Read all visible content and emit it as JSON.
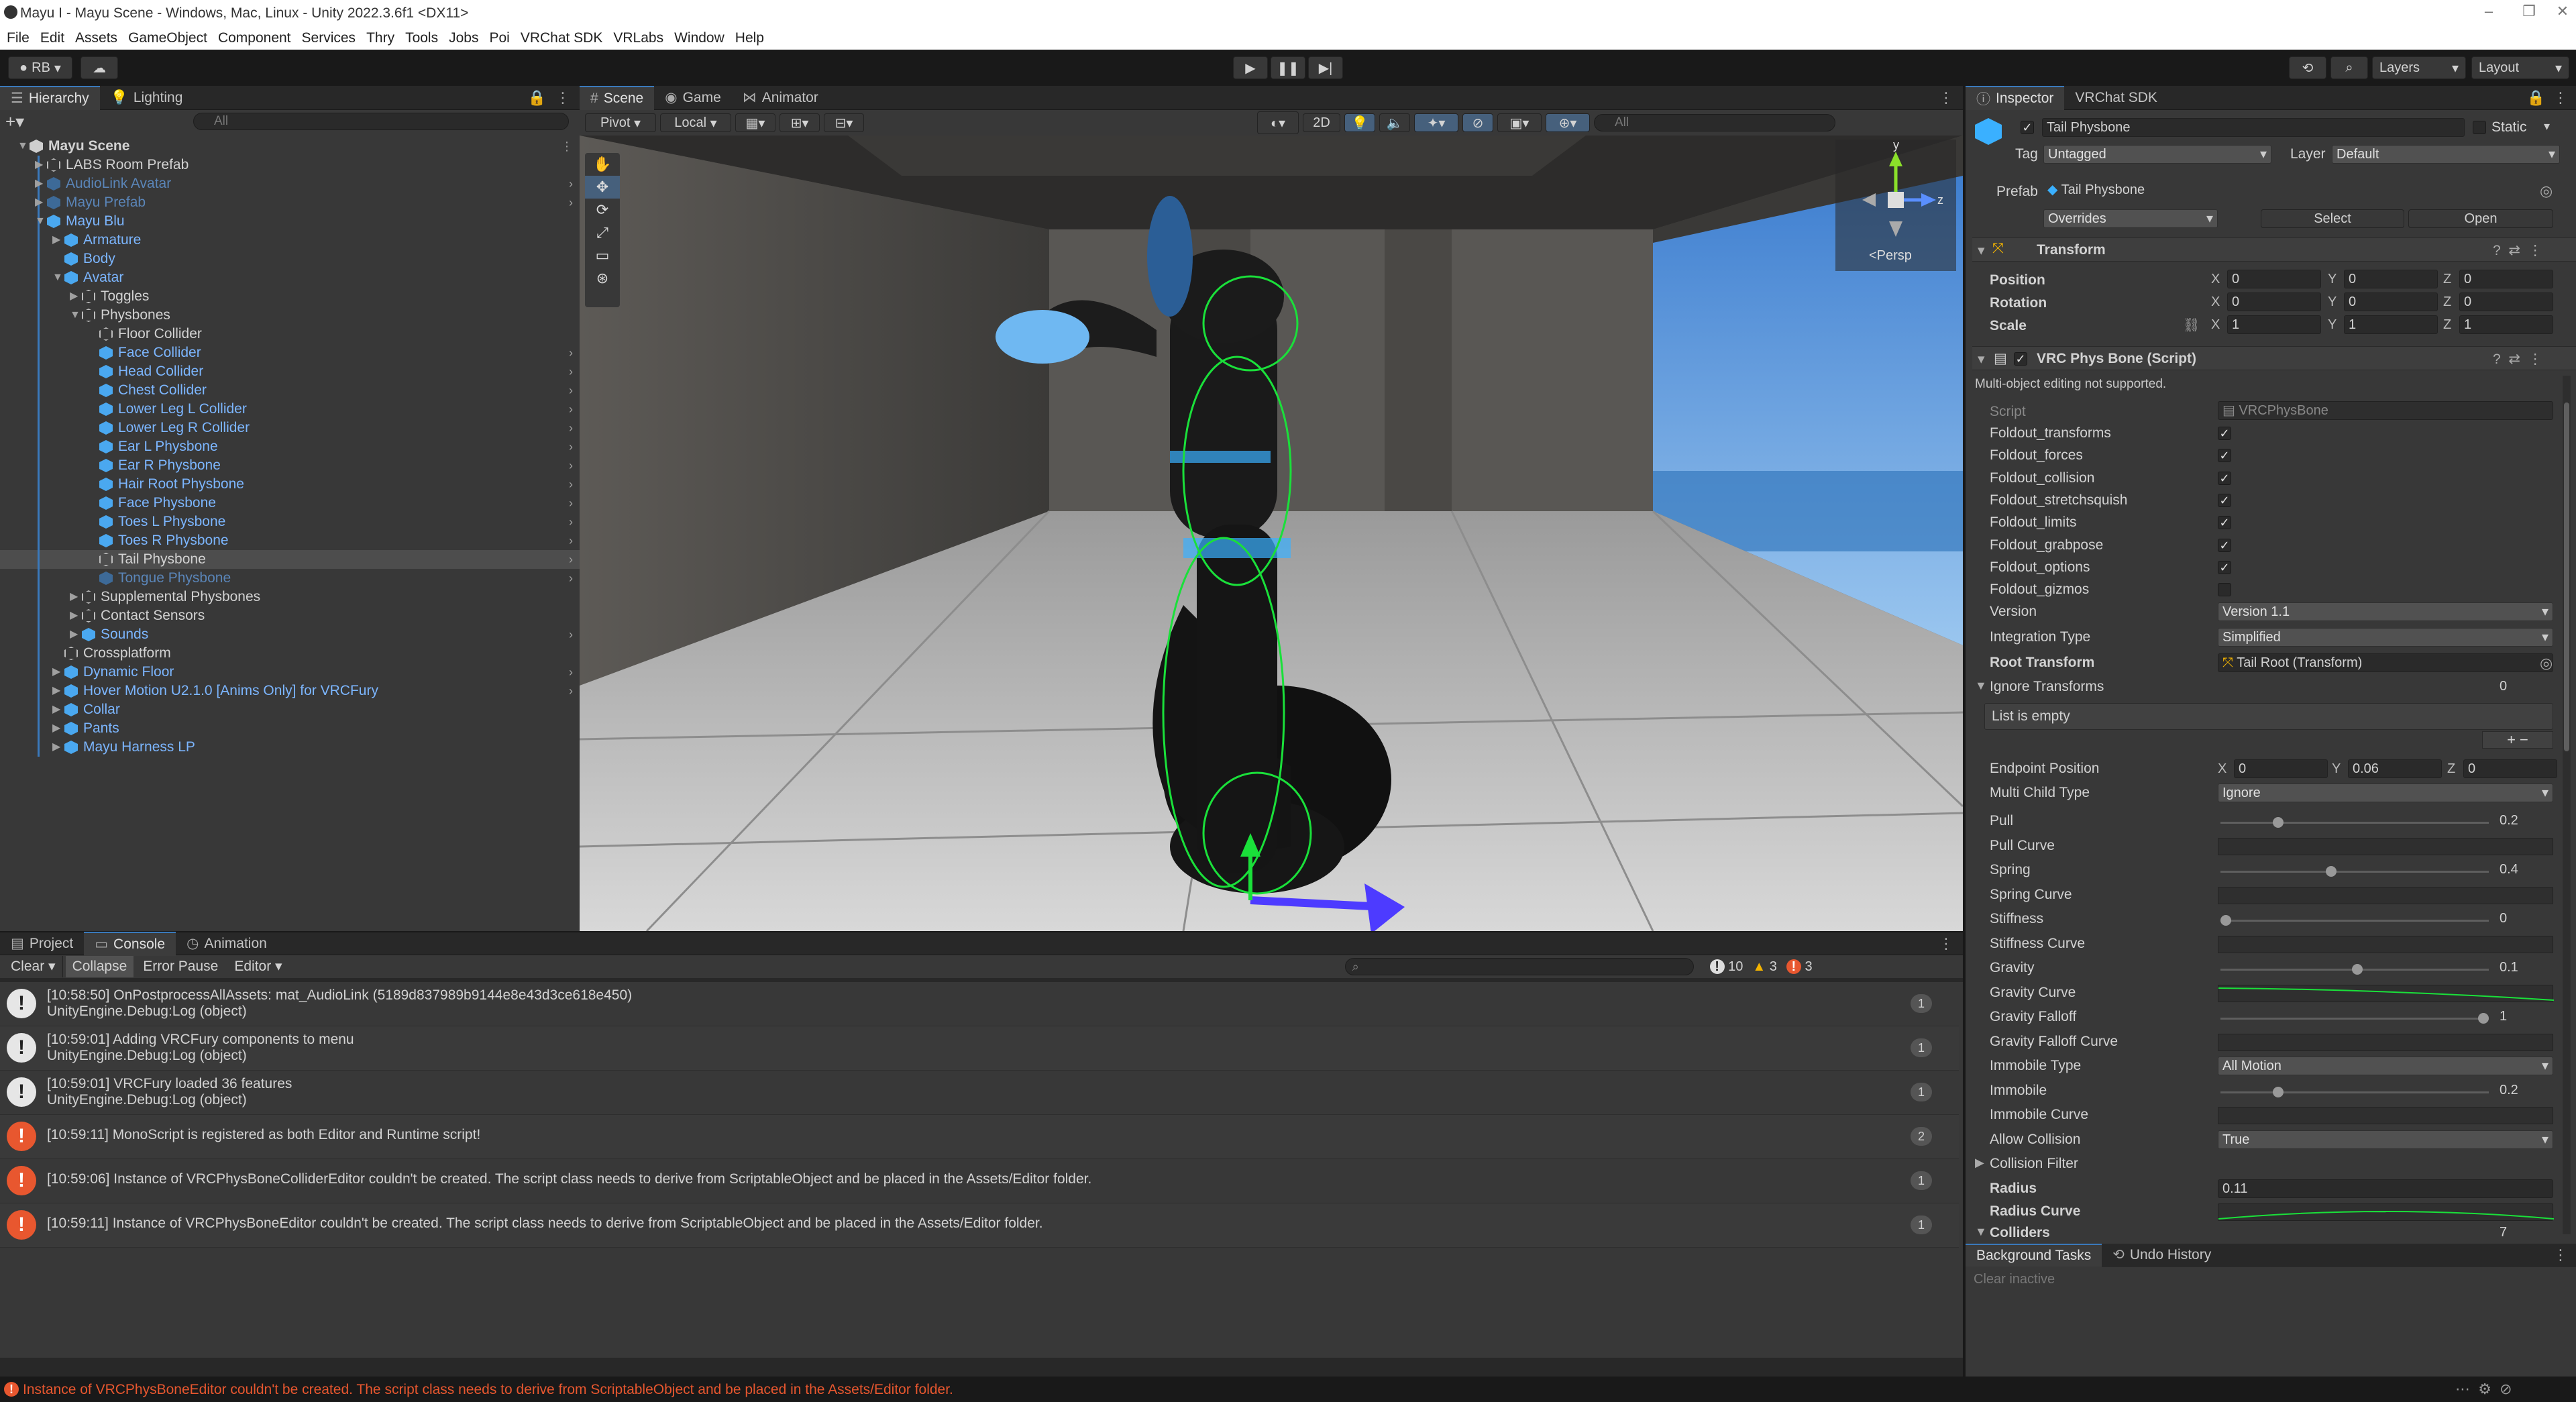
{
  "window": {
    "title": "Mayu I - Mayu Scene - Windows, Mac, Linux - Unity 2022.3.6f1 <DX11>"
  },
  "menu": [
    "File",
    "Edit",
    "Assets",
    "GameObject",
    "Component",
    "Services",
    "Thry",
    "Tools",
    "Jobs",
    "Poi",
    "VRChat SDK",
    "VRLabs",
    "Window",
    "Help"
  ],
  "toolbar": {
    "account": "RB",
    "layers": "Layers",
    "layout": "Layout"
  },
  "hierarchy": {
    "tabs": [
      "Hierarchy",
      "Lighting"
    ],
    "search_placeholder": "All",
    "rows": [
      {
        "label": "Mayu Scene",
        "depth": 0,
        "kind": "scene",
        "arrow": "down"
      },
      {
        "label": "LABS Room Prefab",
        "depth": 1,
        "kind": "obj",
        "arrow": "right"
      },
      {
        "label": "AudioLink Avatar",
        "depth": 1,
        "kind": "prefabdim",
        "arrow": "right",
        "chev": true
      },
      {
        "label": "Mayu Prefab",
        "depth": 1,
        "kind": "prefabdim",
        "arrow": "right",
        "chev": true
      },
      {
        "label": "Mayu Blu",
        "depth": 1,
        "kind": "prefab",
        "arrow": "down"
      },
      {
        "label": "Armature",
        "depth": 2,
        "kind": "prefab",
        "arrow": "right"
      },
      {
        "label": "Body",
        "depth": 2,
        "kind": "prefab",
        "arrow": ""
      },
      {
        "label": "Avatar",
        "depth": 2,
        "kind": "prefab",
        "arrow": "down"
      },
      {
        "label": "Toggles",
        "depth": 3,
        "kind": "obj",
        "arrow": "right"
      },
      {
        "label": "Physbones",
        "depth": 3,
        "kind": "obj",
        "arrow": "down"
      },
      {
        "label": "Floor Collider",
        "depth": 4,
        "kind": "obj",
        "arrow": ""
      },
      {
        "label": "Face Collider",
        "depth": 4,
        "kind": "prefab",
        "arrow": "",
        "chev": true
      },
      {
        "label": "Head Collider",
        "depth": 4,
        "kind": "prefab",
        "arrow": "",
        "chev": true
      },
      {
        "label": "Chest Collider",
        "depth": 4,
        "kind": "prefab",
        "arrow": "",
        "chev": true
      },
      {
        "label": "Lower Leg L Collider",
        "depth": 4,
        "kind": "prefab",
        "arrow": "",
        "chev": true
      },
      {
        "label": "Lower Leg R Collider",
        "depth": 4,
        "kind": "prefab",
        "arrow": "",
        "chev": true
      },
      {
        "label": "Ear L Physbone",
        "depth": 4,
        "kind": "prefab",
        "arrow": "",
        "chev": true
      },
      {
        "label": "Ear R Physbone",
        "depth": 4,
        "kind": "prefab",
        "arrow": "",
        "chev": true
      },
      {
        "label": "Hair Root Physbone",
        "depth": 4,
        "kind": "prefab",
        "arrow": "",
        "chev": true
      },
      {
        "label": "Face Physbone",
        "depth": 4,
        "kind": "prefab",
        "arrow": "",
        "chev": true
      },
      {
        "label": "Toes L Physbone",
        "depth": 4,
        "kind": "prefab",
        "arrow": "",
        "chev": true
      },
      {
        "label": "Toes R Physbone",
        "depth": 4,
        "kind": "prefab",
        "arrow": "",
        "chev": true
      },
      {
        "label": "Tail Physbone",
        "depth": 4,
        "kind": "obj",
        "arrow": "",
        "chev": true,
        "selected": true
      },
      {
        "label": "Tongue Physbone",
        "depth": 4,
        "kind": "prefabdim",
        "arrow": "",
        "chev": true
      },
      {
        "label": "Supplemental Physbones",
        "depth": 3,
        "kind": "obj",
        "arrow": "right"
      },
      {
        "label": "Contact Sensors",
        "depth": 3,
        "kind": "obj",
        "arrow": "right"
      },
      {
        "label": "Sounds",
        "depth": 3,
        "kind": "prefab",
        "arrow": "right",
        "chev": true
      },
      {
        "label": "Crossplatform",
        "depth": 2,
        "kind": "obj",
        "arrow": ""
      },
      {
        "label": "Dynamic Floor",
        "depth": 2,
        "kind": "prefab",
        "arrow": "right",
        "chev": true
      },
      {
        "label": "Hover Motion U2.1.0 [Anims Only] for VRCFury",
        "depth": 2,
        "kind": "prefab",
        "arrow": "right",
        "chev": true
      },
      {
        "label": "Collar",
        "depth": 2,
        "kind": "prefab",
        "arrow": "right"
      },
      {
        "label": "Pants",
        "depth": 2,
        "kind": "prefab",
        "arrow": "right"
      },
      {
        "label": "Mayu Harness LP",
        "depth": 2,
        "kind": "prefab",
        "arrow": "right"
      }
    ]
  },
  "scene": {
    "tabs": [
      "Scene",
      "Game",
      "Animator"
    ],
    "pivot": "Pivot",
    "local": "Local",
    "mode2d": "2D",
    "search_placeholder": "All",
    "gizmo": {
      "y": "y",
      "z": "z",
      "persp": "<Persp"
    }
  },
  "console": {
    "tabs": [
      "Project",
      "Console",
      "Animation"
    ],
    "buttons": [
      "Clear",
      "Collapse",
      "Error Pause",
      "Editor"
    ],
    "counts": {
      "info": "10",
      "warn": "3",
      "error": "3"
    },
    "entries": [
      {
        "type": "info",
        "line1": "[10:58:50] OnPostprocessAllAssets: mat_AudioLink (5189d837989b9144e8e43d3ce618e450)",
        "line2": "UnityEngine.Debug:Log (object)",
        "count": "1"
      },
      {
        "type": "info",
        "line1": "[10:59:01] Adding VRCFury components to menu",
        "line2": "UnityEngine.Debug:Log (object)",
        "count": "1"
      },
      {
        "type": "info",
        "line1": "[10:59:01] VRCFury loaded 36 features",
        "line2": "UnityEngine.Debug:Log (object)",
        "count": "1"
      },
      {
        "type": "error",
        "line1": "[10:59:11] MonoScript is registered as both Editor and Runtime script!",
        "line2": "",
        "count": "2"
      },
      {
        "type": "error",
        "line1": "[10:59:06] Instance of VRCPhysBoneColliderEditor couldn't be created. The script class needs to derive from ScriptableObject and be placed in the Assets/Editor folder.",
        "line2": "",
        "count": "1"
      },
      {
        "type": "error",
        "line1": "[10:59:11] Instance of VRCPhysBoneEditor couldn't be created. The script class needs to derive from ScriptableObject and be placed in the Assets/Editor folder.",
        "line2": "",
        "count": "1"
      }
    ]
  },
  "statusbar": {
    "message": "Instance of VRCPhysBoneEditor couldn't be created. The script class needs to derive from ScriptableObject and be placed in the Assets/Editor folder."
  },
  "inspector": {
    "tabs": [
      "Inspector",
      "VRChat SDK"
    ],
    "name": "Tail Physbone",
    "static": "Static",
    "tag_label": "Tag",
    "tag": "Untagged",
    "layer_label": "Layer",
    "layer": "Default",
    "prefab_label": "Prefab",
    "prefab": "Tail Physbone",
    "overrides": "Overrides",
    "select": "Select",
    "open": "Open",
    "transform": {
      "title": "Transform",
      "position": {
        "label": "Position",
        "x": "0",
        "y": "0",
        "z": "0"
      },
      "rotation": {
        "label": "Rotation",
        "x": "0",
        "y": "0",
        "z": "0"
      },
      "scale": {
        "label": "Scale",
        "x": "1",
        "y": "1",
        "z": "1"
      }
    },
    "physbone": {
      "title": "VRC Phys Bone (Script)",
      "warning": "Multi-object editing not supported.",
      "script_label": "Script",
      "script": "VRCPhysBone",
      "foldouts": [
        {
          "label": "Foldout_transforms",
          "checked": true
        },
        {
          "label": "Foldout_forces",
          "checked": true
        },
        {
          "label": "Foldout_collision",
          "checked": true
        },
        {
          "label": "Foldout_stretchsquish",
          "checked": true
        },
        {
          "label": "Foldout_limits",
          "checked": true
        },
        {
          "label": "Foldout_grabpose",
          "checked": true
        },
        {
          "label": "Foldout_options",
          "checked": true
        },
        {
          "label": "Foldout_gizmos",
          "checked": false
        }
      ],
      "version_label": "Version",
      "version": "Version 1.1",
      "integration_label": "Integration Type",
      "integration": "Simplified",
      "root_label": "Root Transform",
      "root": "Tail Root (Transform)",
      "ignore_label": "Ignore Transforms",
      "ignore_count": "0",
      "list_empty": "List is empty",
      "endpoint": {
        "label": "Endpoint Position",
        "x": "0",
        "y": "0.06",
        "z": "0"
      },
      "multichild_label": "Multi Child Type",
      "multichild": "Ignore",
      "pull": {
        "label": "Pull",
        "value": "0.2"
      },
      "pull_curve": "Pull Curve",
      "spring": {
        "label": "Spring",
        "value": "0.4"
      },
      "spring_curve": "Spring Curve",
      "stiffness": {
        "label": "Stiffness",
        "value": "0"
      },
      "stiffness_curve": "Stiffness Curve",
      "gravity": {
        "label": "Gravity",
        "value": "0.1"
      },
      "gravity_curve": "Gravity Curve",
      "gravity_falloff": {
        "label": "Gravity Falloff",
        "value": "1"
      },
      "gravity_falloff_curve": "Gravity Falloff Curve",
      "immobile_type_label": "Immobile Type",
      "immobile_type": "All Motion",
      "immobile": {
        "label": "Immobile",
        "value": "0.2"
      },
      "immobile_curve": "Immobile Curve",
      "allow_collision_label": "Allow Collision",
      "allow_collision": "True",
      "collision_filter": "Collision Filter",
      "radius": {
        "label": "Radius",
        "value": "0.11"
      },
      "radius_curve": "Radius Curve",
      "colliders": {
        "label": "Colliders",
        "value": "7"
      }
    }
  },
  "bottom_right": {
    "tabs": [
      "Background Tasks",
      "Undo History"
    ],
    "clear_inactive": "Clear inactive"
  },
  "colors": {
    "accent": "#3a79bb",
    "prefab": "#7cb6ff",
    "error": "#e8572f",
    "warning": "#f4b400"
  }
}
